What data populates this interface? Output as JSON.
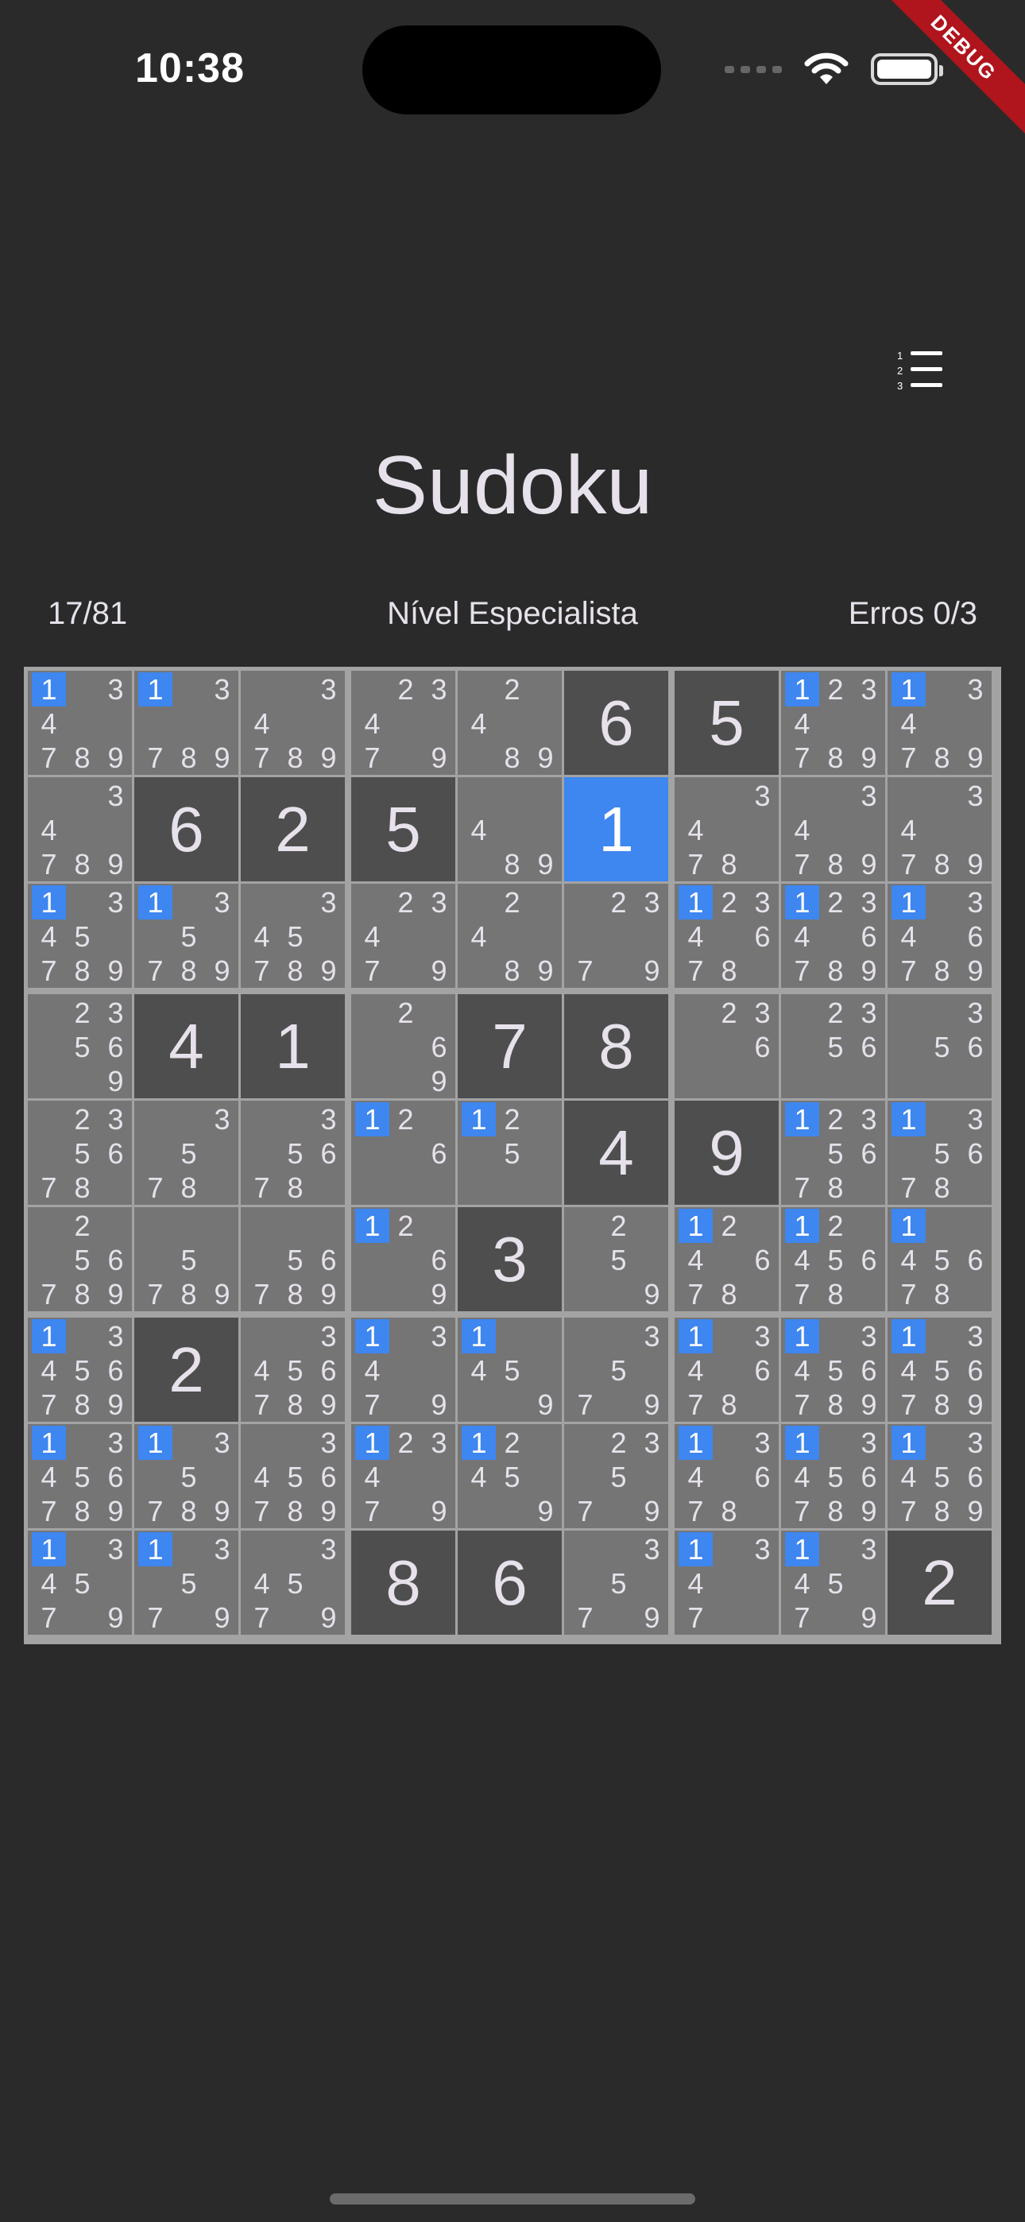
{
  "status_bar": {
    "time": "10:38",
    "icons": [
      "cellular-signal-icon",
      "wifi-icon",
      "battery-icon"
    ]
  },
  "debug_banner": "DEBUG",
  "header": {
    "menu_icon": "numbered-list-icon",
    "title": "Sudoku"
  },
  "stats": {
    "progress": "17/81",
    "level": "Nível Especialista",
    "errors": "Erros 0/3"
  },
  "colors": {
    "background": "#2a2a2a",
    "given_cell": "#4e4e4e",
    "empty_cell": "#757575",
    "selected_cell": "#3e86f0",
    "highlight": "#3e86f0",
    "board_border": "#a3a3a3"
  },
  "board": {
    "selected": {
      "row": 1,
      "col": 5
    },
    "highlight_candidate": 1,
    "rows": [
      [
        {
          "c": [
            1,
            3,
            4,
            7,
            8,
            9
          ]
        },
        {
          "c": [
            1,
            3,
            7,
            8,
            9
          ]
        },
        {
          "c": [
            3,
            4,
            7,
            8,
            9
          ]
        },
        {
          "c": [
            2,
            3,
            4,
            7,
            9
          ]
        },
        {
          "c": [
            2,
            4,
            8,
            9
          ]
        },
        {
          "v": 6
        },
        {
          "v": 5
        },
        {
          "c": [
            1,
            2,
            3,
            4,
            7,
            8,
            9
          ]
        },
        {
          "c": [
            1,
            3,
            4,
            7,
            8,
            9
          ]
        }
      ],
      [
        {
          "c": [
            3,
            4,
            7,
            8,
            9
          ]
        },
        {
          "v": 6
        },
        {
          "v": 2
        },
        {
          "v": 5
        },
        {
          "c": [
            4,
            8,
            9
          ]
        },
        {
          "v": 1
        },
        {
          "c": [
            3,
            4,
            7,
            8
          ]
        },
        {
          "c": [
            3,
            4,
            7,
            8,
            9
          ]
        },
        {
          "c": [
            3,
            4,
            7,
            8,
            9
          ]
        }
      ],
      [
        {
          "c": [
            1,
            3,
            4,
            5,
            7,
            8,
            9
          ]
        },
        {
          "c": [
            1,
            3,
            5,
            7,
            8,
            9
          ]
        },
        {
          "c": [
            3,
            4,
            5,
            7,
            8,
            9
          ]
        },
        {
          "c": [
            2,
            3,
            4,
            7,
            9
          ]
        },
        {
          "c": [
            2,
            4,
            8,
            9
          ]
        },
        {
          "c": [
            2,
            3,
            7,
            9
          ]
        },
        {
          "c": [
            1,
            2,
            3,
            4,
            6,
            7,
            8
          ]
        },
        {
          "c": [
            1,
            2,
            3,
            4,
            6,
            7,
            8,
            9
          ]
        },
        {
          "c": [
            1,
            3,
            4,
            6,
            7,
            8,
            9
          ]
        }
      ],
      [
        {
          "c": [
            2,
            3,
            5,
            6,
            9
          ]
        },
        {
          "v": 4
        },
        {
          "v": 1
        },
        {
          "c": [
            2,
            6,
            9
          ]
        },
        {
          "v": 7
        },
        {
          "v": 8
        },
        {
          "c": [
            2,
            3,
            6
          ]
        },
        {
          "c": [
            2,
            3,
            5,
            6
          ]
        },
        {
          "c": [
            3,
            5,
            6
          ]
        }
      ],
      [
        {
          "c": [
            2,
            3,
            5,
            6,
            7,
            8
          ]
        },
        {
          "c": [
            3,
            5,
            7,
            8
          ]
        },
        {
          "c": [
            3,
            5,
            6,
            7,
            8
          ]
        },
        {
          "c": [
            1,
            2,
            6
          ]
        },
        {
          "c": [
            1,
            2,
            5
          ]
        },
        {
          "v": 4
        },
        {
          "v": 9
        },
        {
          "c": [
            1,
            2,
            3,
            5,
            6,
            7,
            8
          ]
        },
        {
          "c": [
            1,
            3,
            5,
            6,
            7,
            8
          ]
        }
      ],
      [
        {
          "c": [
            2,
            5,
            6,
            7,
            8,
            9
          ]
        },
        {
          "c": [
            5,
            7,
            8,
            9
          ]
        },
        {
          "c": [
            5,
            6,
            7,
            8,
            9
          ]
        },
        {
          "c": [
            1,
            2,
            6,
            9
          ]
        },
        {
          "v": 3
        },
        {
          "c": [
            2,
            5,
            9
          ]
        },
        {
          "c": [
            1,
            2,
            4,
            6,
            7,
            8
          ]
        },
        {
          "c": [
            1,
            2,
            4,
            5,
            6,
            7,
            8
          ]
        },
        {
          "c": [
            1,
            4,
            5,
            6,
            7,
            8
          ]
        }
      ],
      [
        {
          "c": [
            1,
            3,
            4,
            5,
            6,
            7,
            8,
            9
          ]
        },
        {
          "v": 2
        },
        {
          "c": [
            3,
            4,
            5,
            6,
            7,
            8,
            9
          ]
        },
        {
          "c": [
            1,
            3,
            4,
            7,
            9
          ]
        },
        {
          "c": [
            1,
            4,
            5,
            9
          ]
        },
        {
          "c": [
            3,
            5,
            7,
            9
          ]
        },
        {
          "c": [
            1,
            3,
            4,
            6,
            7,
            8
          ]
        },
        {
          "c": [
            1,
            3,
            4,
            5,
            6,
            7,
            8,
            9
          ]
        },
        {
          "c": [
            1,
            3,
            4,
            5,
            6,
            7,
            8,
            9
          ]
        }
      ],
      [
        {
          "c": [
            1,
            3,
            4,
            5,
            6,
            7,
            8,
            9
          ]
        },
        {
          "c": [
            1,
            3,
            5,
            7,
            8,
            9
          ]
        },
        {
          "c": [
            3,
            4,
            5,
            6,
            7,
            8,
            9
          ]
        },
        {
          "c": [
            1,
            2,
            3,
            4,
            7,
            9
          ]
        },
        {
          "c": [
            1,
            2,
            4,
            5,
            9
          ]
        },
        {
          "c": [
            2,
            3,
            5,
            7,
            9
          ]
        },
        {
          "c": [
            1,
            3,
            4,
            6,
            7,
            8
          ]
        },
        {
          "c": [
            1,
            3,
            4,
            5,
            6,
            7,
            8,
            9
          ]
        },
        {
          "c": [
            1,
            3,
            4,
            5,
            6,
            7,
            8,
            9
          ]
        }
      ],
      [
        {
          "c": [
            1,
            3,
            4,
            5,
            7,
            9
          ]
        },
        {
          "c": [
            1,
            3,
            5,
            7,
            9
          ]
        },
        {
          "c": [
            3,
            4,
            5,
            7,
            9
          ]
        },
        {
          "v": 8
        },
        {
          "v": 6
        },
        {
          "c": [
            3,
            5,
            7,
            9
          ]
        },
        {
          "c": [
            1,
            3,
            4,
            7
          ]
        },
        {
          "c": [
            1,
            3,
            4,
            5,
            7,
            9
          ]
        },
        {
          "v": 2
        }
      ]
    ]
  }
}
